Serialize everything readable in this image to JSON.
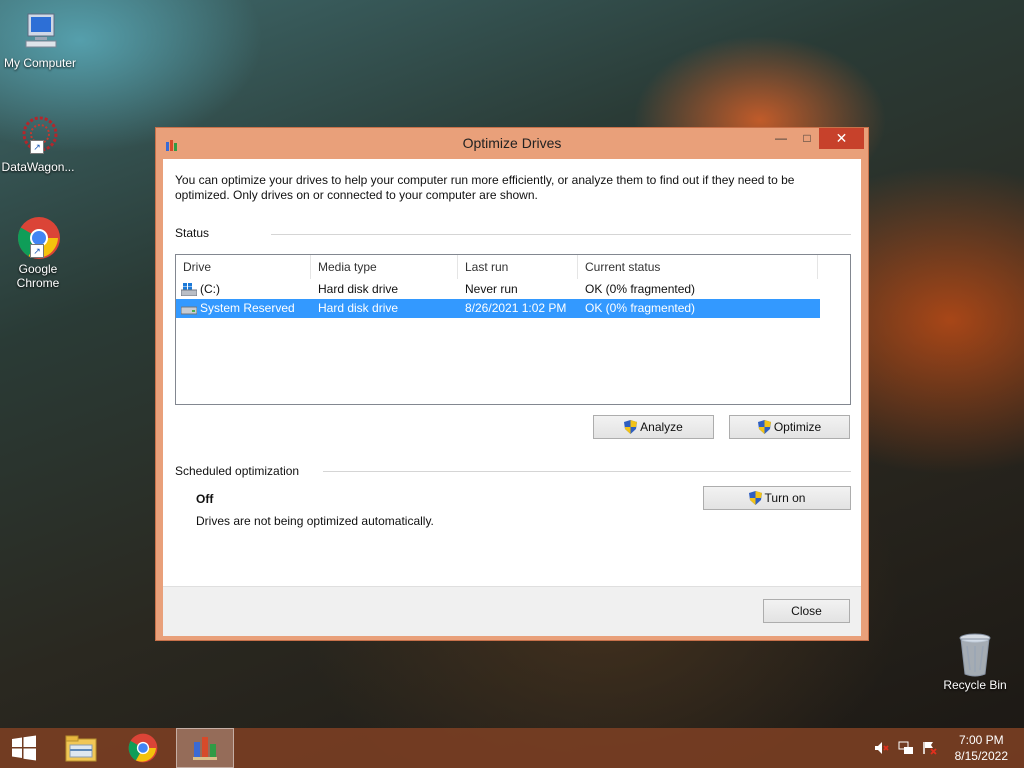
{
  "desktop": {
    "icons": [
      {
        "label": "My Computer"
      },
      {
        "label": "DataWagon..."
      },
      {
        "label_line1": "Google",
        "label_line2": "Chrome"
      },
      {
        "label": "Recycle Bin"
      }
    ]
  },
  "window": {
    "title": "Optimize Drives",
    "description": "You can optimize your drives to help your computer run more efficiently, or analyze them to find out if they need to be optimized. Only drives on or connected to your computer are shown.",
    "status_label": "Status",
    "columns": [
      "Drive",
      "Media type",
      "Last run",
      "Current status"
    ],
    "drives": [
      {
        "drive": "(C:)",
        "media_type": "Hard disk drive",
        "last_run": "Never run",
        "status": "OK (0% fragmented)",
        "selected": false
      },
      {
        "drive": "System Reserved",
        "media_type": "Hard disk drive",
        "last_run": "8/26/2021 1:02 PM",
        "status": "OK (0% fragmented)",
        "selected": true
      }
    ],
    "analyze_label": "Analyze",
    "optimize_label": "Optimize",
    "scheduled_label": "Scheduled optimization",
    "schedule_state": "Off",
    "schedule_desc": "Drives are not being optimized automatically.",
    "turn_on_label": "Turn on",
    "close_label": "Close"
  },
  "taskbar": {
    "time": "7:00 PM",
    "date": "8/15/2022"
  },
  "colors": {
    "selection": "#3399ff",
    "window_frame": "#e9a07a",
    "close_button": "#c7412b",
    "taskbar": "#783e23"
  }
}
